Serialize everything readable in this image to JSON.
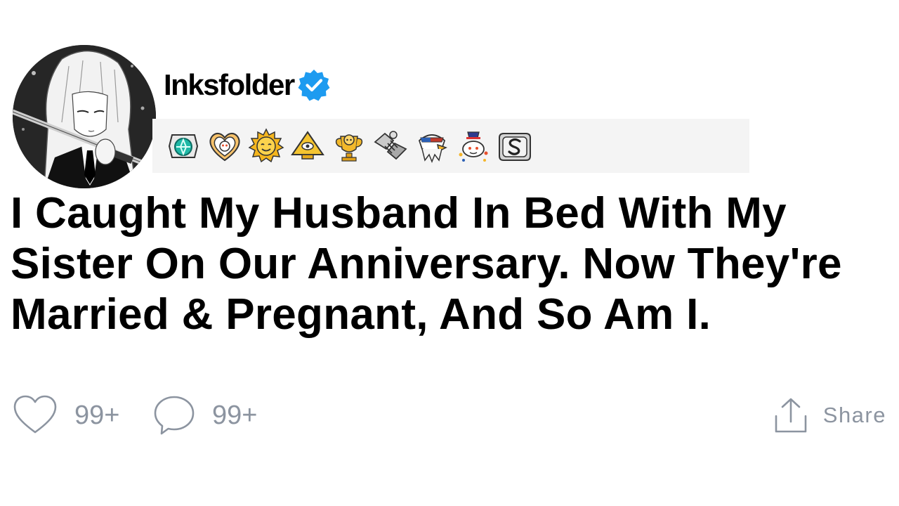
{
  "post": {
    "author": {
      "username": "Inksfolder",
      "verified": true,
      "avatar_icon": "anime-girl-with-sword-avatar"
    },
    "awards": [
      {
        "icon": "teal-gem-award-icon"
      },
      {
        "icon": "wholesome-heart-award-icon"
      },
      {
        "icon": "sun-face-award-icon"
      },
      {
        "icon": "pyramid-eye-award-icon"
      },
      {
        "icon": "gold-trophy-snoo-award-icon"
      },
      {
        "icon": "handshake-award-icon"
      },
      {
        "icon": "eagle-award-icon"
      },
      {
        "icon": "snoo-confetti-award-icon"
      },
      {
        "icon": "silver-s-award-icon"
      }
    ],
    "title": "I Caught My Husband In Bed With My Sister On Our Anniversary. Now They're Married & Pregnant, And So Am I.",
    "actions": {
      "likes": "99+",
      "comments": "99+",
      "share_label": "Share"
    }
  },
  "colors": {
    "verified_badge": "#1d9bf0",
    "action_gray": "#8c94a0",
    "awards_bar_bg": "#f4f4f4"
  }
}
